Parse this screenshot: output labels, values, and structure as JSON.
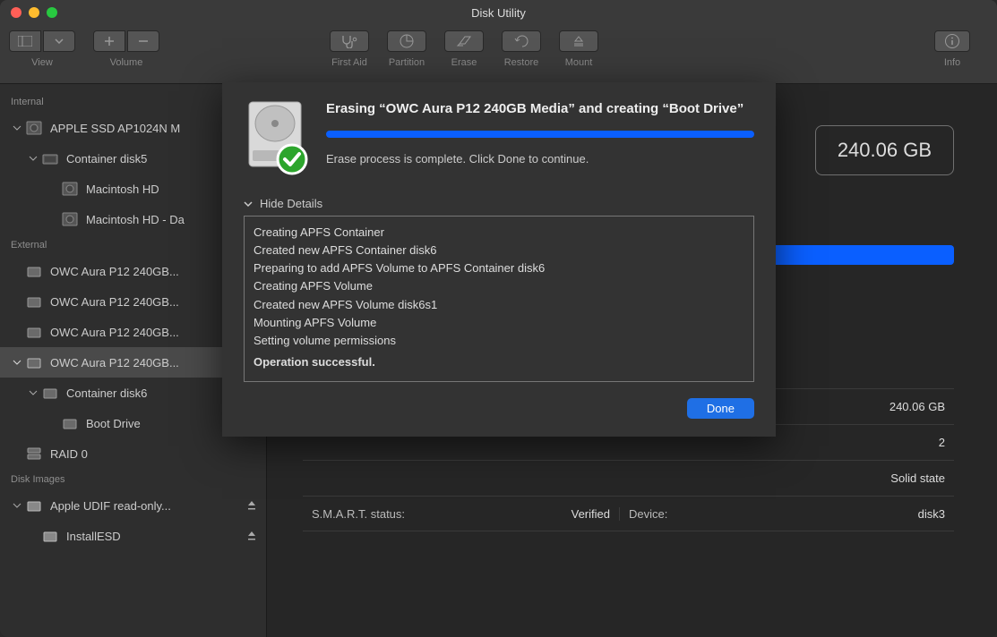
{
  "window": {
    "title": "Disk Utility"
  },
  "traffic": {
    "close": "#ff5f57",
    "min": "#febc2e",
    "max": "#28c840"
  },
  "toolbar": {
    "view": "View",
    "volume": "Volume",
    "firstaid": "First Aid",
    "partition": "Partition",
    "erase": "Erase",
    "restore": "Restore",
    "mount": "Mount",
    "info": "Info"
  },
  "sidebar": {
    "sections": {
      "internal": "Internal",
      "external": "External",
      "disk_images": "Disk Images"
    },
    "items": {
      "apple_ssd": "APPLE SSD AP1024N M",
      "container_disk5": "Container disk5",
      "macintosh_hd": "Macintosh HD",
      "macintosh_hd_data": "Macintosh HD - Da",
      "owc1": "OWC Aura P12 240GB...",
      "owc2": "OWC Aura P12 240GB...",
      "owc3": "OWC Aura P12 240GB...",
      "owc4": "OWC Aura P12 240GB...",
      "container_disk6": "Container disk6",
      "boot_drive": "Boot Drive",
      "raid0": "RAID 0",
      "apple_udif": "Apple UDIF read-only...",
      "installesd": "InstallESD"
    }
  },
  "main": {
    "capacity": "240.06 GB",
    "info": {
      "row1": {
        "rv": "240.06 GB"
      },
      "row2": {
        "rv": "2"
      },
      "row3": {
        "rv": "Solid state"
      },
      "row4": {
        "ll": "S.M.A.R.T. status:",
        "lv": "Verified",
        "rl": "Device:",
        "rv": "disk3"
      }
    }
  },
  "sheet": {
    "title": "Erasing “OWC Aura P12 240GB Media” and creating “Boot Drive”",
    "message": "Erase process is complete. Click Done to continue.",
    "details_toggle": "Hide Details",
    "log": [
      "Creating APFS Container",
      "Created new APFS Container disk6",
      "Preparing to add APFS Volume to APFS Container disk6",
      "Creating APFS Volume",
      "Created new APFS Volume disk6s1",
      "Mounting APFS Volume",
      "Setting volume permissions"
    ],
    "success": "Operation successful.",
    "done": "Done"
  }
}
